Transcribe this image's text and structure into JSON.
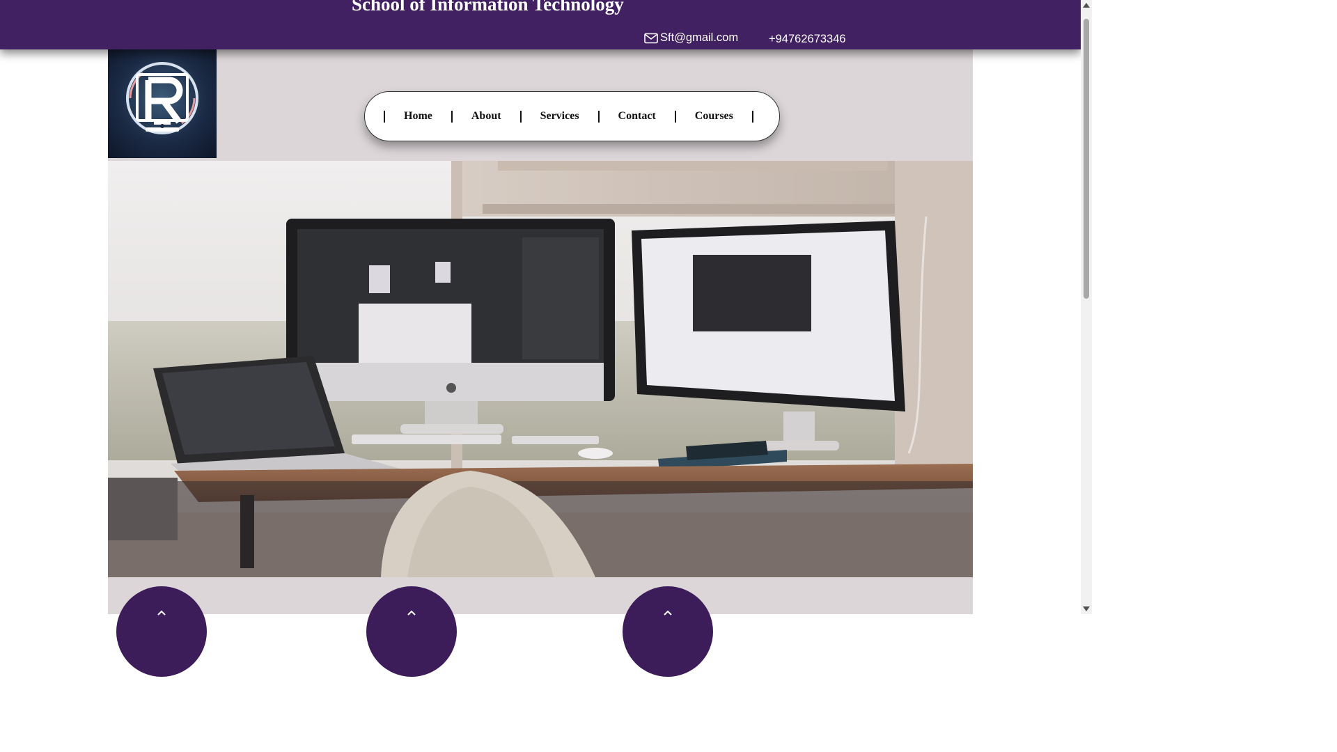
{
  "header": {
    "title": "School of Information Technology",
    "email": "Sft@gmail.com",
    "phone": "+94762673346",
    "email_icon": "mail-icon"
  },
  "logo": {
    "icon": "logo-icon"
  },
  "nav": {
    "items": [
      {
        "label": "Home"
      },
      {
        "label": "About"
      },
      {
        "label": "Services"
      },
      {
        "label": "Contact"
      },
      {
        "label": "Courses"
      }
    ]
  },
  "hero": {
    "icon": "desk-workspace-image"
  },
  "features": {
    "icon": "chevron-up-icon"
  },
  "colors": {
    "header_bg": "#412161",
    "page_bg": "#dcd6d9",
    "circle_bg": "#3c1d5a",
    "nav_bg": "#ffffff"
  }
}
